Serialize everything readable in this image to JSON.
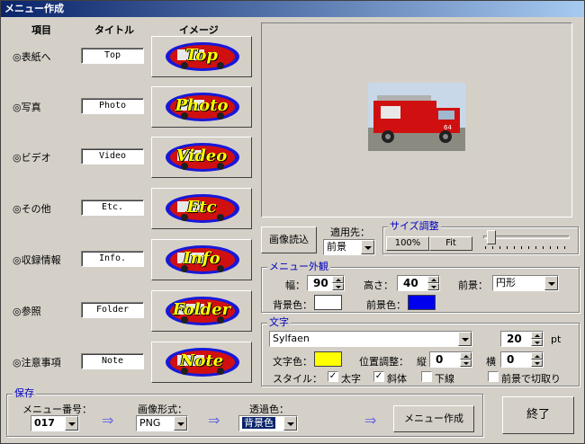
{
  "window": {
    "title": "メニュー作成"
  },
  "columns": {
    "item": "項目",
    "title": "タイトル",
    "image": "イメージ"
  },
  "menu_items": [
    {
      "label": "◎表紙へ",
      "title": "Top",
      "caption": "Top"
    },
    {
      "label": "◎写真",
      "title": "Photo",
      "caption": "Photo"
    },
    {
      "label": "◎ビデオ",
      "title": "Video",
      "caption": "Video"
    },
    {
      "label": "◎その他",
      "title": "Etc.",
      "caption": "Etc"
    },
    {
      "label": "◎収録情報",
      "title": "Info.",
      "caption": "Info"
    },
    {
      "label": "◎参照",
      "title": "Folder",
      "caption": "Folder"
    },
    {
      "label": "◎注意事項",
      "title": "Note",
      "caption": "Note"
    }
  ],
  "image_controls": {
    "load_button": "画像読込",
    "apply_label": "適用先：",
    "apply_value": "前景"
  },
  "size_group": {
    "title": "サイズ調整",
    "btn_100": "100%",
    "btn_fit": "Fit",
    "slider_value": 0.05
  },
  "appearance": {
    "title": "メニュー外観",
    "width_label": "幅：",
    "width_value": "90",
    "height_label": "高さ：",
    "height_value": "40",
    "fg_label": "前景：",
    "fg_value": "円形",
    "bg_color_label": "背景色：",
    "bg_color": "#ffffff",
    "fg_color_label": "前景色：",
    "fg_color": "#0000ee"
  },
  "text_group": {
    "title": "文字",
    "font": "Sylfaen",
    "size": "20",
    "unit": "pt",
    "color_label": "文字色：",
    "color": "#ffff00",
    "pos_label": "位置調整：",
    "vert_label": "縦",
    "vert_value": "0",
    "horiz_label": "横",
    "horiz_value": "0",
    "style_label": "スタイル：",
    "bold_label": "太字",
    "bold_checked": true,
    "italic_label": "斜体",
    "italic_checked": true,
    "underline_label": "下線",
    "underline_checked": false,
    "cutout_label": "前景で切取り",
    "cutout_checked": false
  },
  "save_group": {
    "title": "保存",
    "menu_no_label": "メニュー番号：",
    "menu_no_value": "017",
    "format_label": "画像形式：",
    "format_value": "PNG",
    "transparent_label": "透過色：",
    "transparent_value": "背景色",
    "arrow": "⇒",
    "create_button": "メニュー作成"
  },
  "exit_button": "終了",
  "colors": {
    "title_start": "#0a246a",
    "title_end": "#a6caf0",
    "face": "#d4d0c8",
    "group_title": "#0000c0",
    "truck_red": "#d01010"
  }
}
